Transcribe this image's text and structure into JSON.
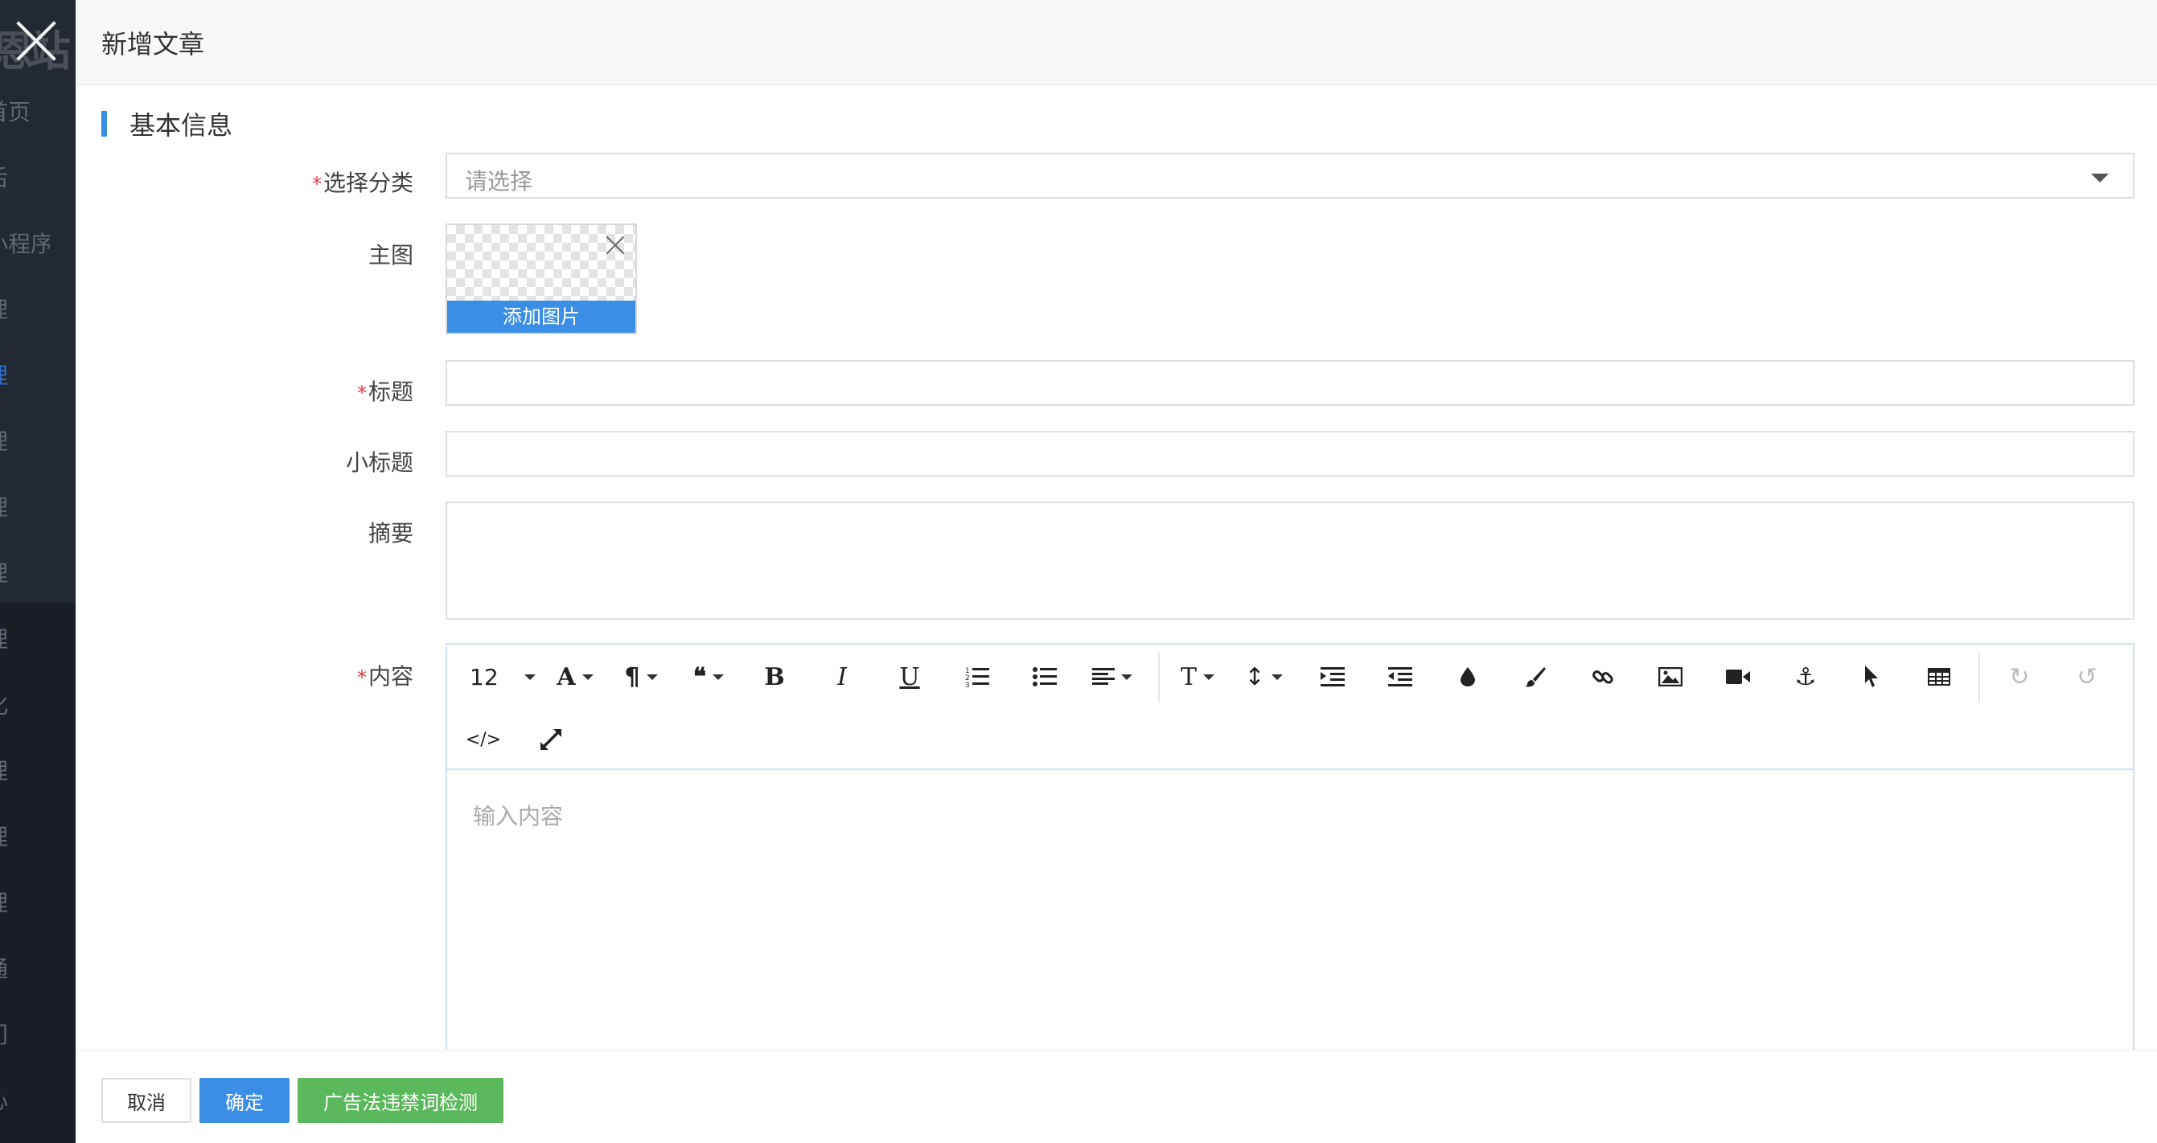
{
  "sidebar": {
    "logo": "恩站",
    "items": [
      {
        "label": "首页"
      },
      {
        "label": "后"
      },
      {
        "label": "小程序"
      },
      {
        "label": "理"
      },
      {
        "label": "理"
      },
      {
        "label": "理"
      },
      {
        "label": "理"
      },
      {
        "label": "理"
      },
      {
        "label": "理"
      },
      {
        "label": "化"
      },
      {
        "label": "理"
      },
      {
        "label": "理"
      },
      {
        "label": "理"
      },
      {
        "label": "通"
      },
      {
        "label": "门"
      },
      {
        "label": "心"
      }
    ]
  },
  "modal": {
    "title": "新增文章",
    "section_title": "基本信息",
    "form": {
      "category": {
        "label": "选择分类",
        "required": "*",
        "placeholder": "请选择"
      },
      "main_image": {
        "label": "主图",
        "add_button": "添加图片"
      },
      "title": {
        "label": "标题",
        "required": "*",
        "value": ""
      },
      "subtitle": {
        "label": "小标题",
        "value": ""
      },
      "summary": {
        "label": "摘要",
        "value": ""
      },
      "content": {
        "label": "内容",
        "required": "*",
        "placeholder": "输入内容"
      }
    },
    "editor_toolbar": {
      "font_size": "12",
      "icons": [
        "font-color-icon",
        "paragraph-icon",
        "quote-icon",
        "bold-icon",
        "italic-icon",
        "underline-icon",
        "ordered-list-icon",
        "unordered-list-icon",
        "align-icon",
        "text-format-icon",
        "line-height-icon",
        "indent-icon",
        "outdent-icon",
        "color-drop-icon",
        "brush-icon",
        "link-icon",
        "image-icon",
        "video-icon",
        "anchor-icon",
        "cursor-icon",
        "table-icon",
        "redo-icon",
        "undo-icon",
        "code-icon",
        "fullscreen-icon"
      ]
    },
    "footer": {
      "cancel": "取消",
      "confirm": "确定",
      "check": "广告法违禁词检测"
    }
  },
  "colors": {
    "primary": "#3a8ee6",
    "success": "#5cb85c",
    "required": "#e4393c",
    "sidebar": "#191d24"
  }
}
